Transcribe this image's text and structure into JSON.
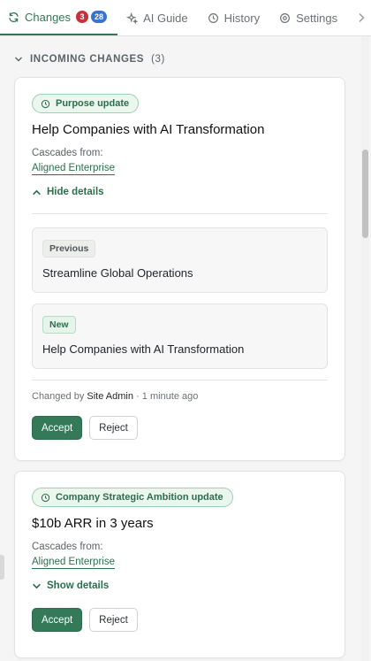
{
  "tabs": [
    {
      "label": "Changes",
      "icon": "refresh-icon",
      "active": true,
      "badges": [
        "3",
        "28"
      ]
    },
    {
      "label": "AI Guide",
      "icon": "sparkle-icon"
    },
    {
      "label": "History",
      "icon": "clock-icon"
    },
    {
      "label": "Settings",
      "icon": "gear-icon"
    }
  ],
  "section": {
    "title": "INCOMING CHANGES",
    "count": "(3)"
  },
  "cards": [
    {
      "pill": "Purpose update",
      "title": "Help Companies with AI Transformation",
      "cascade_label": "Cascades from:",
      "cascade_link": "Aligned Enterprise",
      "toggle": "Hide details",
      "previous_tag": "Previous",
      "previous_value": "Streamline Global Operations",
      "new_tag": "New",
      "new_value": "Help Companies with AI Transformation",
      "changed_by_prefix": "Changed by",
      "changed_by": "Site Admin",
      "changed_when": "· 1 minute ago",
      "accept": "Accept",
      "reject": "Reject"
    },
    {
      "pill": "Company Strategic Ambition update",
      "title": "$10b ARR in 3 years",
      "cascade_label": "Cascades from:",
      "cascade_link": "Aligned Enterprise",
      "toggle": "Show details",
      "accept": "Accept",
      "reject": "Reject"
    }
  ],
  "colors": {
    "accent": "#2f7a55",
    "badge_red": "#c9303e",
    "badge_blue": "#3a72d1"
  }
}
